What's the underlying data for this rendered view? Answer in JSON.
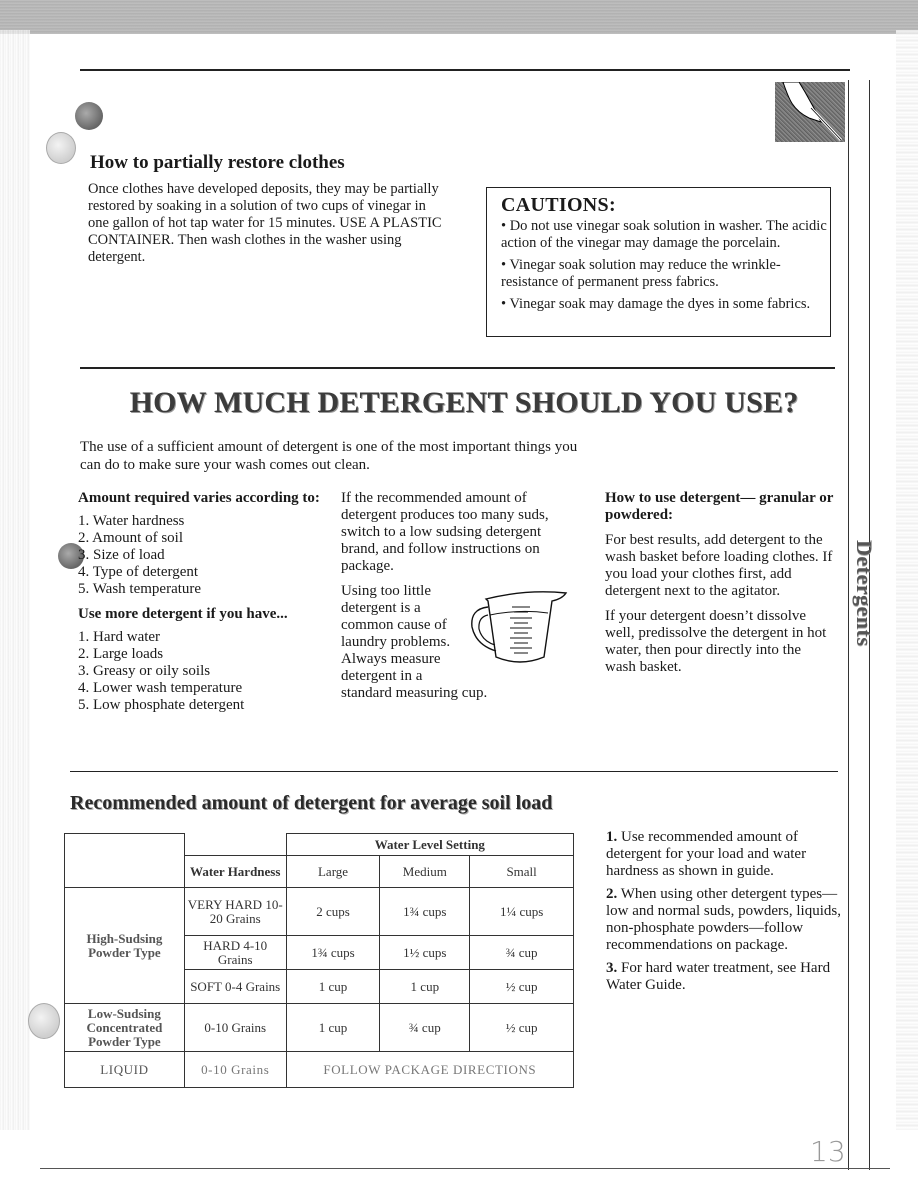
{
  "restore": {
    "title": "How to partially restore clothes",
    "body": "Once clothes have developed deposits, they may be partially restored by soaking in a solution of two cups of vinegar in one gallon of hot tap water for 15 minutes. USE A PLASTIC CONTAINER. Then wash clothes in the washer using detergent."
  },
  "cautions": {
    "title": "CAUTIONS:",
    "items": [
      "• Do not use vinegar soak solution in washer. The acidic action of the vinegar may damage the porcelain.",
      "• Vinegar soak solution may reduce the wrinkle-resistance of permanent press fabrics.",
      "• Vinegar soak may damage the dyes in some fabrics."
    ]
  },
  "main": {
    "title": "HOW MUCH DETERGENT SHOULD YOU USE?",
    "intro": "The use of a sufficient amount of detergent is one of the most important things you can do to make sure your wash comes out clean."
  },
  "amount_varies": {
    "heading": "Amount required varies according to:",
    "items": [
      "1. Water hardness",
      "2. Amount of soil",
      "3. Size of load",
      "4. Type of detergent",
      "5. Wash temperature"
    ]
  },
  "use_more": {
    "heading": "Use more detergent if you have...",
    "items": [
      "1. Hard water",
      "2. Large loads",
      "3. Greasy or oily soils",
      "4. Lower wash temperature",
      "5. Low phosphate detergent"
    ]
  },
  "suds": {
    "para1": "If the recommended amount of detergent produces too many suds, switch to a low sudsing detergent brand, and follow instructions on package.",
    "para2_narrow": "Using too little detergent is a common cause of laundry problems. Always measure detergent in a",
    "para2_end": "standard measuring cup."
  },
  "how_to_use": {
    "heading": "How to use detergent— granular or powdered:",
    "para1": "For best results, add detergent to the wash basket before loading clothes. If you load your clothes first, add detergent next to the agitator.",
    "para2": "If your detergent doesn’t dissolve well, predissolve the detergent in hot water, then pour directly into the wash basket."
  },
  "table": {
    "title": "Recommended amount of detergent for average soil load",
    "header_group": "Water Level Setting",
    "header_hardness": "Water Hardness",
    "columns": [
      "Large",
      "Medium",
      "Small"
    ],
    "groups": [
      {
        "label": "High-Sudsing Powder Type",
        "rows": [
          {
            "hardness": "VERY HARD 10-20 Grains",
            "values": [
              "2 cups",
              "1¾ cups",
              "1¼ cups"
            ]
          },
          {
            "hardness": "HARD 4-10 Grains",
            "values": [
              "1¾ cups",
              "1½ cups",
              "¾ cup"
            ]
          },
          {
            "hardness": "SOFT 0-4 Grains",
            "values": [
              "1 cup",
              "1 cup",
              "½ cup"
            ]
          }
        ]
      },
      {
        "label": "Low-Sudsing Concentrated Powder Type",
        "rows": [
          {
            "hardness": "0-10 Grains",
            "values": [
              "1 cup",
              "¾ cup",
              "½ cup"
            ]
          }
        ]
      },
      {
        "label": "LIQUID",
        "rows": [
          {
            "hardness": "0-10 Grains",
            "span_text": "FOLLOW PACKAGE DIRECTIONS"
          }
        ]
      }
    ]
  },
  "notes": [
    {
      "num": "1.",
      "text": "Use recommended amount of detergent for your load and water hardness as shown in guide."
    },
    {
      "num": "2.",
      "text": "When using other detergent types—low and normal suds, powders, liquids, non-phosphate powders—follow recommendations on package."
    },
    {
      "num": "3.",
      "text": "For hard water treatment, see Hard Water Guide."
    }
  ],
  "side_tab": "Detergents",
  "page_number": "13"
}
